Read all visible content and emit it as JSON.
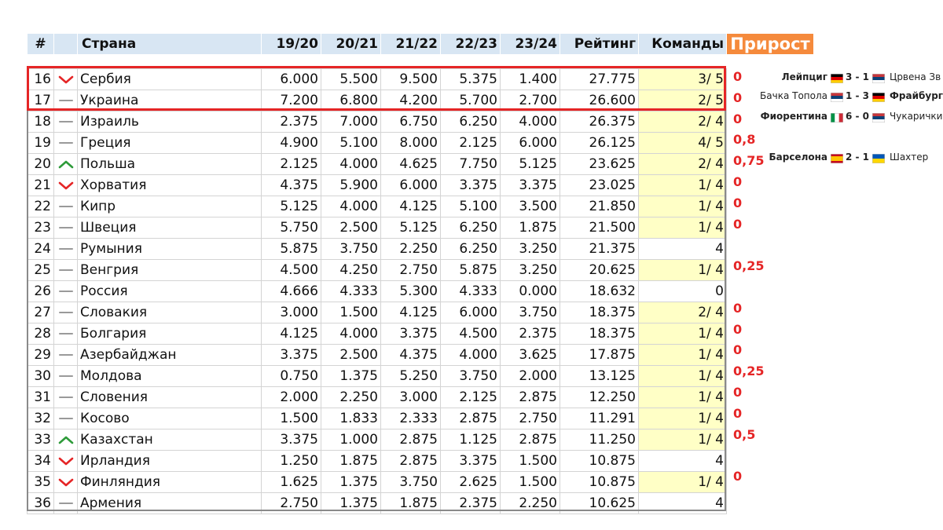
{
  "table": {
    "headers": {
      "rank": "#",
      "trend": "",
      "country": "Страна",
      "s1": "19/20",
      "s2": "20/21",
      "s3": "21/22",
      "s4": "22/23",
      "s5": "23/24",
      "rating": "Рейтинг",
      "teams": "Команды"
    },
    "rows": [
      {
        "rank": "16",
        "trend": "down",
        "country": "Сербия",
        "s1": "6.000",
        "s2": "5.500",
        "s3": "9.500",
        "s4": "5.375",
        "s5": "1.400",
        "rating": "27.775",
        "teams": "3/ 5",
        "teams_highlight": true,
        "growth": "0"
      },
      {
        "rank": "17",
        "trend": "flat",
        "country": "Украина",
        "s1": "7.200",
        "s2": "6.800",
        "s3": "4.200",
        "s4": "5.700",
        "s5": "2.700",
        "rating": "26.600",
        "teams": "2/ 5",
        "teams_highlight": true,
        "growth": "0"
      },
      {
        "rank": "18",
        "trend": "flat",
        "country": "Израиль",
        "s1": "2.375",
        "s2": "7.000",
        "s3": "6.750",
        "s4": "6.250",
        "s5": "4.000",
        "rating": "26.375",
        "teams": "2/ 4",
        "teams_highlight": true,
        "growth": "0"
      },
      {
        "rank": "19",
        "trend": "flat",
        "country": "Греция",
        "s1": "4.900",
        "s2": "5.100",
        "s3": "8.000",
        "s4": "2.125",
        "s5": "6.000",
        "rating": "26.125",
        "teams": "4/ 5",
        "teams_highlight": true,
        "growth": "0,8"
      },
      {
        "rank": "20",
        "trend": "up",
        "country": "Польша",
        "s1": "2.125",
        "s2": "4.000",
        "s3": "4.625",
        "s4": "7.750",
        "s5": "5.125",
        "rating": "23.625",
        "teams": "2/ 4",
        "teams_highlight": true,
        "growth": "0,75"
      },
      {
        "rank": "21",
        "trend": "down",
        "country": "Хорватия",
        "s1": "4.375",
        "s2": "5.900",
        "s3": "6.000",
        "s4": "3.375",
        "s5": "3.375",
        "rating": "23.025",
        "teams": "1/ 4",
        "teams_highlight": true,
        "growth": "0"
      },
      {
        "rank": "22",
        "trend": "flat",
        "country": "Кипр",
        "s1": "5.125",
        "s2": "4.000",
        "s3": "4.125",
        "s4": "5.100",
        "s5": "3.500",
        "rating": "21.850",
        "teams": "1/ 4",
        "teams_highlight": true,
        "growth": "0"
      },
      {
        "rank": "23",
        "trend": "flat",
        "country": "Швеция",
        "s1": "5.750",
        "s2": "2.500",
        "s3": "5.125",
        "s4": "6.250",
        "s5": "1.875",
        "rating": "21.500",
        "teams": "1/ 4",
        "teams_highlight": true,
        "growth": "0"
      },
      {
        "rank": "24",
        "trend": "flat",
        "country": "Румыния",
        "s1": "5.875",
        "s2": "3.750",
        "s3": "2.250",
        "s4": "6.250",
        "s5": "3.250",
        "rating": "21.375",
        "teams": "4",
        "teams_highlight": false,
        "growth": ""
      },
      {
        "rank": "25",
        "trend": "flat",
        "country": "Венгрия",
        "s1": "4.500",
        "s2": "4.250",
        "s3": "2.750",
        "s4": "5.875",
        "s5": "3.250",
        "rating": "20.625",
        "teams": "1/ 4",
        "teams_highlight": true,
        "growth": "0,25"
      },
      {
        "rank": "26",
        "trend": "flat",
        "country": "Россия",
        "s1": "4.666",
        "s2": "4.333",
        "s3": "5.300",
        "s4": "4.333",
        "s5": "0.000",
        "rating": "18.632",
        "teams": "0",
        "teams_highlight": false,
        "growth": ""
      },
      {
        "rank": "27",
        "trend": "flat",
        "country": "Словакия",
        "s1": "3.000",
        "s2": "1.500",
        "s3": "4.125",
        "s4": "6.000",
        "s5": "3.750",
        "rating": "18.375",
        "teams": "2/ 4",
        "teams_highlight": true,
        "growth": "0"
      },
      {
        "rank": "28",
        "trend": "flat",
        "country": "Болгария",
        "s1": "4.125",
        "s2": "4.000",
        "s3": "3.375",
        "s4": "4.500",
        "s5": "2.375",
        "rating": "18.375",
        "teams": "1/ 4",
        "teams_highlight": true,
        "growth": "0"
      },
      {
        "rank": "29",
        "trend": "flat",
        "country": "Азербайджан",
        "s1": "3.375",
        "s2": "2.500",
        "s3": "4.375",
        "s4": "4.000",
        "s5": "3.625",
        "rating": "17.875",
        "teams": "1/ 4",
        "teams_highlight": true,
        "growth": "0"
      },
      {
        "rank": "30",
        "trend": "flat",
        "country": "Молдова",
        "s1": "0.750",
        "s2": "1.375",
        "s3": "5.250",
        "s4": "3.750",
        "s5": "2.000",
        "rating": "13.125",
        "teams": "1/ 4",
        "teams_highlight": true,
        "growth": "0,25"
      },
      {
        "rank": "31",
        "trend": "flat",
        "country": "Словения",
        "s1": "2.000",
        "s2": "2.250",
        "s3": "3.000",
        "s4": "2.125",
        "s5": "2.875",
        "rating": "12.250",
        "teams": "1/ 4",
        "teams_highlight": true,
        "growth": "0"
      },
      {
        "rank": "32",
        "trend": "flat",
        "country": "Косово",
        "s1": "1.500",
        "s2": "1.833",
        "s3": "2.333",
        "s4": "2.875",
        "s5": "2.750",
        "rating": "11.291",
        "teams": "1/ 4",
        "teams_highlight": true,
        "growth": "0"
      },
      {
        "rank": "33",
        "trend": "up",
        "country": "Казахстан",
        "s1": "3.375",
        "s2": "1.000",
        "s3": "2.875",
        "s4": "1.125",
        "s5": "2.875",
        "rating": "11.250",
        "teams": "1/ 4",
        "teams_highlight": true,
        "growth": "0,5"
      },
      {
        "rank": "34",
        "trend": "down",
        "country": "Ирландия",
        "s1": "1.250",
        "s2": "1.875",
        "s3": "2.875",
        "s4": "3.375",
        "s5": "1.500",
        "rating": "10.875",
        "teams": "4",
        "teams_highlight": false,
        "growth": ""
      },
      {
        "rank": "35",
        "trend": "down",
        "country": "Финляндия",
        "s1": "1.625",
        "s2": "1.375",
        "s3": "3.750",
        "s4": "2.625",
        "s5": "1.500",
        "rating": "10.875",
        "teams": "1/ 4",
        "teams_highlight": true,
        "growth": "0"
      },
      {
        "rank": "36",
        "trend": "flat",
        "country": "Армения",
        "s1": "2.750",
        "s2": "1.375",
        "s3": "1.875",
        "s4": "2.375",
        "s5": "2.250",
        "rating": "10.625",
        "teams": "4",
        "teams_highlight": false,
        "growth": ""
      }
    ]
  },
  "growth_header": "Прирост",
  "matches": [
    {
      "home": "Лейпциг",
      "home_bold": true,
      "home_flag": "germany",
      "score": "3 - 1",
      "away_flag": "serbia",
      "away": "Црвена Зв",
      "away_bold": false
    },
    {
      "home": "Бачка Топола",
      "home_bold": false,
      "home_flag": "serbia",
      "score": "1 - 3",
      "away_flag": "germany",
      "away": "Фрайбург",
      "away_bold": true
    },
    {
      "home": "Фиорентина",
      "home_bold": true,
      "home_flag": "italy",
      "score": "6 - 0",
      "away_flag": "serbia",
      "away": "Чукарички",
      "away_bold": false
    },
    {
      "home": "Барселона",
      "home_bold": true,
      "home_flag": "spain",
      "score": "2 - 1",
      "away_flag": "ukraine",
      "away": "Шахтер",
      "away_bold": false
    }
  ],
  "colors": {
    "header_bg": "#d8e6f3",
    "teams_highlight": "#ffffc6",
    "growth_header_bg": "#f58a3c",
    "growth_text": "#e52526",
    "trend_up": "#2e9b3a",
    "trend_down": "#e52526",
    "trend_flat": "#9a9a9a",
    "frame_red": "#e52526"
  }
}
